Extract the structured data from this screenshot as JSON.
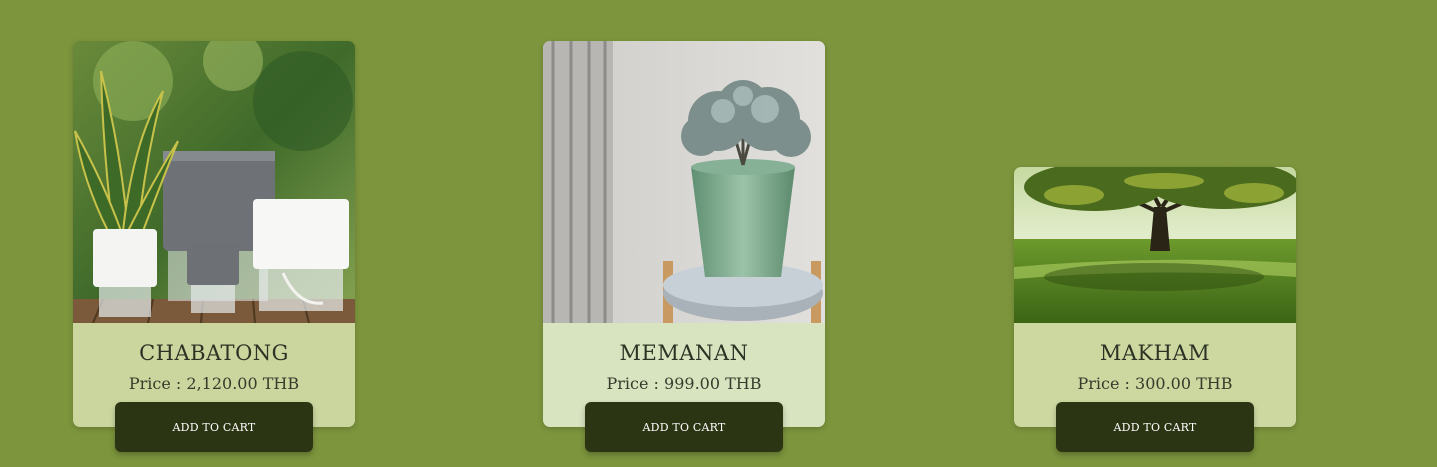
{
  "products": [
    {
      "name": "CHABATONG",
      "price": "Price : 2,120.00 THB",
      "button": "ADD TO CART",
      "image": "snake-plant-self-watering-pots"
    },
    {
      "name": "MEMANAN",
      "price": "Price : 999.00 THB",
      "button": "ADD TO CART",
      "image": "potted-plant-green-ceramic-pot"
    },
    {
      "name": "MAKHAM",
      "price": "Price : 300.00 THB",
      "button": "ADD TO CART",
      "image": "tamarind-tree-in-meadow"
    }
  ],
  "colors": {
    "background": "#7d953d",
    "button": "#2c3513",
    "card_1_body": "#cbd69f",
    "card_2_body": "#d8e3c0",
    "card_3_body": "#cdd8a1"
  }
}
